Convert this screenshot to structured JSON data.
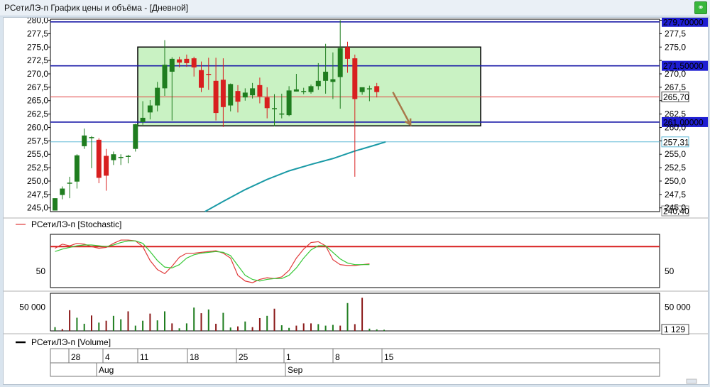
{
  "window": {
    "title": "РСетиЛЭ-п График цены и объёма - [Дневной]"
  },
  "chart_data": [
    {
      "type": "candlestick",
      "panel": "price",
      "ylim": [
        244.3,
        280.2
      ],
      "y_ticks": [
        "280,0",
        "277,5",
        "275,0",
        "272,5",
        "270,0",
        "267,5",
        "265,0",
        "262,5",
        "260,0",
        "257,5",
        "255,0",
        "252,5",
        "250,0",
        "247,5",
        "245,0"
      ],
      "y_tick_values": [
        280,
        277.5,
        275,
        272.5,
        270,
        267.5,
        265,
        262.5,
        260,
        257.5,
        255,
        252.5,
        250,
        247.5,
        245
      ],
      "candles": [
        {
          "o": 244.5,
          "h": 246.8,
          "l": 244.5,
          "c": 246.8
        },
        {
          "o": 247.4,
          "h": 249.0,
          "l": 246.6,
          "c": 248.6
        },
        {
          "o": 249.6,
          "h": 250.8,
          "l": 246.8,
          "c": 249.7
        },
        {
          "o": 249.9,
          "h": 255.0,
          "l": 248.6,
          "c": 254.8
        },
        {
          "o": 256.5,
          "h": 259.8,
          "l": 256.0,
          "c": 258.5
        },
        {
          "o": 258.0,
          "h": 258.4,
          "l": 252.4,
          "c": 258.2
        },
        {
          "o": 257.7,
          "h": 258.0,
          "l": 249.6,
          "c": 250.6
        },
        {
          "o": 254.7,
          "h": 256.0,
          "l": 248.2,
          "c": 251.0
        },
        {
          "o": 253.9,
          "h": 255.5,
          "l": 253.0,
          "c": 255.0
        },
        {
          "o": 254.5,
          "h": 255.0,
          "l": 253.0,
          "c": 254.5
        },
        {
          "o": 254.7,
          "h": 254.9,
          "l": 253.3,
          "c": 254.7
        },
        {
          "o": 256.0,
          "h": 260.7,
          "l": 255.5,
          "c": 260.6
        },
        {
          "o": 261.0,
          "h": 264.9,
          "l": 260.5,
          "c": 261.8
        },
        {
          "o": 262.8,
          "h": 265.1,
          "l": 261.5,
          "c": 264.1
        },
        {
          "o": 264.1,
          "h": 268.5,
          "l": 263.0,
          "c": 267.4
        },
        {
          "o": 267.3,
          "h": 276.3,
          "l": 265.9,
          "c": 271.7
        },
        {
          "o": 270.4,
          "h": 273.1,
          "l": 261.3,
          "c": 272.8
        },
        {
          "o": 272.7,
          "h": 273.2,
          "l": 271.2,
          "c": 272.1
        },
        {
          "o": 272.8,
          "h": 273.6,
          "l": 271.3,
          "c": 272.0
        },
        {
          "o": 272.9,
          "h": 273.2,
          "l": 269.5,
          "c": 271.2
        },
        {
          "o": 270.7,
          "h": 272.3,
          "l": 266.6,
          "c": 267.4
        },
        {
          "o": 270.0,
          "h": 273.0,
          "l": 267.0,
          "c": 269.8
        },
        {
          "o": 268.7,
          "h": 273.0,
          "l": 261.3,
          "c": 262.7
        },
        {
          "o": 268.9,
          "h": 272.9,
          "l": 260.1,
          "c": 263.8
        },
        {
          "o": 264.1,
          "h": 268.2,
          "l": 263.0,
          "c": 268.1
        },
        {
          "o": 266.8,
          "h": 267.9,
          "l": 262.8,
          "c": 264.8
        },
        {
          "o": 265.6,
          "h": 267.3,
          "l": 265.0,
          "c": 266.5
        },
        {
          "o": 266.0,
          "h": 268.3,
          "l": 265.4,
          "c": 267.3
        },
        {
          "o": 267.9,
          "h": 269.3,
          "l": 264.5,
          "c": 265.8
        },
        {
          "o": 265.6,
          "h": 267.5,
          "l": 261.7,
          "c": 263.6
        },
        {
          "o": 263.6,
          "h": 266.2,
          "l": 260.2,
          "c": 263.6
        },
        {
          "o": 262.6,
          "h": 266.3,
          "l": 261.7,
          "c": 262.6
        },
        {
          "o": 262.3,
          "h": 267.7,
          "l": 262.1,
          "c": 266.9
        },
        {
          "o": 266.7,
          "h": 270.0,
          "l": 266.7,
          "c": 267.1
        },
        {
          "o": 266.8,
          "h": 267.4,
          "l": 266.2,
          "c": 266.8
        },
        {
          "o": 266.6,
          "h": 268.0,
          "l": 266.3,
          "c": 267.7
        },
        {
          "o": 267.7,
          "h": 272.0,
          "l": 267.0,
          "c": 268.7
        },
        {
          "o": 268.7,
          "h": 275.6,
          "l": 266.3,
          "c": 270.4
        },
        {
          "o": 268.5,
          "h": 274.0,
          "l": 265.3,
          "c": 269.0
        },
        {
          "o": 269.4,
          "h": 280.0,
          "l": 263.5,
          "c": 274.8
        },
        {
          "o": 275.0,
          "h": 276.0,
          "l": 270.2,
          "c": 272.8
        },
        {
          "o": 272.9,
          "h": 273.6,
          "l": 250.8,
          "c": 265.3
        },
        {
          "o": 266.6,
          "h": 267.1,
          "l": 266.1,
          "c": 267.5
        },
        {
          "o": 267.3,
          "h": 267.8,
          "l": 264.9,
          "c": 267.3
        },
        {
          "o": 267.7,
          "h": 268.3,
          "l": 265.6,
          "c": 266.6
        }
      ],
      "ma_line": [
        {
          "i": 20.5,
          "v": 244.3
        },
        {
          "i": 23,
          "v": 246.2
        },
        {
          "i": 26,
          "v": 248.4
        },
        {
          "i": 29,
          "v": 250.3
        },
        {
          "i": 32,
          "v": 251.9
        },
        {
          "i": 35,
          "v": 253.1
        },
        {
          "i": 38,
          "v": 254.2
        },
        {
          "i": 41,
          "v": 255.6
        },
        {
          "i": 44,
          "v": 256.8
        },
        {
          "i": 45.2,
          "v": 257.31
        }
      ],
      "horizontal_levels": [
        {
          "value": 279.7,
          "label": "279,70000",
          "color": "#1b1ba8",
          "type": "hline"
        },
        {
          "value": 271.5,
          "label": "271,50000",
          "color": "#1b1ba8",
          "type": "hline"
        },
        {
          "value": 261.0,
          "label": "261,00000",
          "color": "#1b1ba8",
          "type": "hline"
        },
        {
          "value": 265.7,
          "label": "265,70",
          "color": "#e23c3c",
          "type": "last-price"
        },
        {
          "value": 257.31,
          "label": "257,31",
          "color": "#5fb8d6",
          "type": "ma-value"
        },
        {
          "value": 240.4,
          "label": "240,40",
          "color": "#9b8a3a",
          "type": "low-value"
        }
      ],
      "range_box": {
        "x_from": 15,
        "x_to": 60,
        "y_low": 260.3,
        "y_high": 275.0,
        "fill": "#c9f2c3"
      },
      "arrow": {
        "from_i": 46.2,
        "from_v": 266.6,
        "to_i": 48.6,
        "to_v": 260.5,
        "color": "#a8784a"
      },
      "colors": {
        "up": "#1f7d1f",
        "down": "#d81f1f"
      }
    },
    {
      "type": "line",
      "panel": "stochastic",
      "legend": "РСетиЛЭ-п [Stochastic]",
      "y_ticks": [
        "50"
      ],
      "level_line": 80,
      "series": [
        {
          "color": "#e03a3a",
          "values": [
            78,
            83,
            81,
            84,
            83,
            80,
            78,
            79,
            84,
            88,
            88,
            87,
            80,
            63,
            52,
            47,
            56,
            67,
            72,
            72,
            73,
            74,
            75,
            72,
            66,
            45,
            38,
            36,
            40,
            42,
            41,
            43,
            51,
            66,
            77,
            85,
            86,
            81,
            64,
            58,
            57,
            57,
            58,
            59
          ]
        },
        {
          "color": "#37c837",
          "values": [
            74,
            77,
            79,
            81,
            82,
            82,
            81,
            80,
            82,
            85,
            87,
            87,
            84,
            74,
            63,
            55,
            54,
            58,
            66,
            70,
            72,
            73,
            74,
            73,
            69,
            57,
            45,
            40,
            38,
            40,
            41,
            41,
            45,
            54,
            66,
            76,
            81,
            81,
            73,
            65,
            60,
            58,
            58,
            58
          ]
        }
      ]
    },
    {
      "type": "bar",
      "panel": "volume",
      "legend": "РСетиЛЭ-п [Volume]",
      "y_ticks": [
        "50 000"
      ],
      "last_value_label": "1 129",
      "values": [
        10,
        5,
        55,
        35,
        19,
        41,
        22,
        27,
        40,
        31,
        52,
        14,
        27,
        46,
        28,
        52,
        20,
        7,
        20,
        62,
        47,
        57,
        19,
        48,
        9,
        12,
        25,
        10,
        34,
        40,
        59,
        15,
        8,
        14,
        20,
        20,
        18,
        14,
        16,
        14,
        74,
        18,
        88,
        6,
        4,
        3
      ],
      "up": [
        1,
        0,
        0,
        1,
        1,
        0,
        1,
        0,
        1,
        1,
        0,
        1,
        1,
        0,
        1,
        1,
        0,
        1,
        1,
        1,
        0,
        1,
        0,
        1,
        1,
        0,
        1,
        0,
        0,
        1,
        0,
        1,
        1,
        0,
        0,
        0,
        1,
        1,
        1,
        0,
        1,
        0,
        0,
        1,
        1,
        1
      ]
    }
  ],
  "x_axis": {
    "day_labels": [
      "28",
      "4",
      "11",
      "18",
      "25",
      "1",
      "8",
      "15"
    ],
    "month_labels": [
      "Aug",
      "Sep"
    ]
  },
  "colors": {
    "background": "#ffffff",
    "window": "#d9e4ee",
    "level_label_fill": "#1e1ed2",
    "grid": "#d0d0d0"
  }
}
